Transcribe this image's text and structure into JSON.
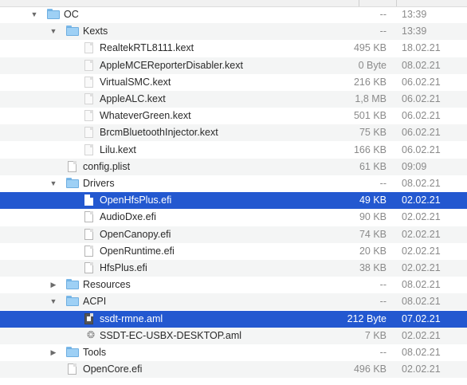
{
  "window": {
    "title": ""
  },
  "colors": {
    "selection": "#2358d0",
    "folder": "#9ed0f5"
  },
  "rows": [
    {
      "name": "OC",
      "size": "--",
      "date": "13:39",
      "kind": "folder",
      "level": 0,
      "expanded": true,
      "selected": false
    },
    {
      "name": "Kexts",
      "size": "--",
      "date": "13:39",
      "kind": "folder",
      "level": 1,
      "expanded": true,
      "selected": false
    },
    {
      "name": "RealtekRTL8111.kext",
      "size": "495 KB",
      "date": "18.02.21",
      "kind": "kext",
      "level": 2,
      "selected": false
    },
    {
      "name": "AppleMCEReporterDisabler.kext",
      "size": "0 Byte",
      "date": "08.02.21",
      "kind": "kext",
      "level": 2,
      "selected": false
    },
    {
      "name": "VirtualSMC.kext",
      "size": "216 KB",
      "date": "06.02.21",
      "kind": "kext",
      "level": 2,
      "selected": false
    },
    {
      "name": "AppleALC.kext",
      "size": "1,8 MB",
      "date": "06.02.21",
      "kind": "kext",
      "level": 2,
      "selected": false
    },
    {
      "name": "WhateverGreen.kext",
      "size": "501 KB",
      "date": "06.02.21",
      "kind": "kext",
      "level": 2,
      "selected": false
    },
    {
      "name": "BrcmBluetoothInjector.kext",
      "size": "75 KB",
      "date": "06.02.21",
      "kind": "kext",
      "level": 2,
      "selected": false
    },
    {
      "name": "Lilu.kext",
      "size": "166 KB",
      "date": "06.02.21",
      "kind": "kext",
      "level": 2,
      "selected": false
    },
    {
      "name": "config.plist",
      "size": "61 KB",
      "date": "09:09",
      "kind": "file",
      "level": 1,
      "selected": false
    },
    {
      "name": "Drivers",
      "size": "--",
      "date": "08.02.21",
      "kind": "folder",
      "level": 1,
      "expanded": true,
      "selected": false
    },
    {
      "name": "OpenHfsPlus.efi",
      "size": "49 KB",
      "date": "02.02.21",
      "kind": "file",
      "level": 2,
      "selected": true
    },
    {
      "name": "AudioDxe.efi",
      "size": "90 KB",
      "date": "02.02.21",
      "kind": "file",
      "level": 2,
      "selected": false
    },
    {
      "name": "OpenCanopy.efi",
      "size": "74 KB",
      "date": "02.02.21",
      "kind": "file",
      "level": 2,
      "selected": false
    },
    {
      "name": "OpenRuntime.efi",
      "size": "20 KB",
      "date": "02.02.21",
      "kind": "file",
      "level": 2,
      "selected": false
    },
    {
      "name": "HfsPlus.efi",
      "size": "38 KB",
      "date": "02.02.21",
      "kind": "file",
      "level": 2,
      "selected": false
    },
    {
      "name": "Resources",
      "size": "--",
      "date": "08.02.21",
      "kind": "folder",
      "level": 1,
      "expanded": false,
      "selected": false
    },
    {
      "name": "ACPI",
      "size": "--",
      "date": "08.02.21",
      "kind": "folder",
      "level": 1,
      "expanded": true,
      "selected": false
    },
    {
      "name": "ssdt-rmne.aml",
      "size": "212 Byte",
      "date": "07.02.21",
      "kind": "aml",
      "level": 2,
      "selected": true
    },
    {
      "name": "SSDT-EC-USBX-DESKTOP.aml",
      "size": "7 KB",
      "date": "02.02.21",
      "kind": "script",
      "level": 2,
      "selected": false
    },
    {
      "name": "Tools",
      "size": "--",
      "date": "08.02.21",
      "kind": "folder",
      "level": 1,
      "expanded": false,
      "selected": false
    },
    {
      "name": "OpenCore.efi",
      "size": "496 KB",
      "date": "02.02.21",
      "kind": "file",
      "level": 1,
      "selected": false
    }
  ]
}
